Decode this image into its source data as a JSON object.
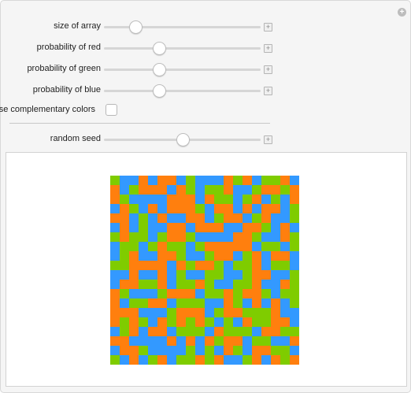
{
  "controls": {
    "size_of_array": {
      "label": "size of array",
      "value": 0.2
    },
    "probability_red": {
      "label": "probability of red",
      "value": 0.35
    },
    "probability_green": {
      "label": "probability of green",
      "value": 0.35
    },
    "probability_blue": {
      "label": "probability of blue",
      "value": 0.35
    },
    "complementary": {
      "label": "use complementary colors",
      "checked": false
    },
    "random_seed": {
      "label": "random seed",
      "value": 0.5
    }
  },
  "grid": {
    "rows": 20,
    "cols": 20,
    "colors": {
      "R": "#ff7f0e",
      "G": "#7fcc00",
      "B": "#3399ff"
    },
    "cells": [
      "GBBRBRRBGBBBRGRBGGRB",
      "RBGRRRBRGBGGRBBGRRGR",
      "RGBBBBRRRBRGGBGRBGBR",
      "BRGBRBRRRGBRRBRBRRBG",
      "RRBGBRBBRRBGRRBGRBBG",
      "BRBGBBRRBRRRBBRRGBRB",
      "GRGGBGRRGBBBBRRGBBRG",
      "BGGBGRGGBGRRRRRBGGBG",
      "BGRBBRRGBBGRRBGRBRRB",
      "GGRRRRBRGRRGBGGRBGGB",
      "BBRBBRBGBBGGBBGRRBBG",
      "BRRGGRBGGRGBBGGRBBRG",
      "RGBBBGRRRBGGRGRRGBGG",
      "RBGGRRBGGGBBRGBRBRBG",
      "RRRBBBGRRRBGRRGGGRBB",
      "RGRGBRGRGRGBGBRGGRRB",
      "BGRBRRBGGGBRGGGBRRGG",
      "RRBBBBRBRBRGRRBGGBBR",
      "BRRGBBBBGBGBRGBRRGGB",
      "GBRBGRBGGRGRBBGRBRGR"
    ]
  }
}
